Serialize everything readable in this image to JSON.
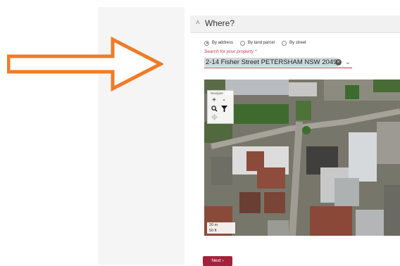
{
  "section": {
    "title": "Where?",
    "collapse_icon": "chevron-up-icon"
  },
  "search_options": [
    {
      "label": "By address",
      "selected": true
    },
    {
      "label": "By land parcel",
      "selected": false
    },
    {
      "label": "By street",
      "selected": false
    }
  ],
  "search": {
    "label": "Search for your property *",
    "value": "2-14 Fisher Street PETERSHAM  NSW  2049",
    "clear_icon": "clear-icon",
    "dropdown_icon": "chevron-down-icon"
  },
  "map": {
    "tools_label": "Navigate",
    "tools": [
      "zoom-in-icon",
      "zoom-out-icon",
      "search-icon",
      "filter-icon",
      "locate-icon"
    ],
    "zoom_in_glyph": "+",
    "zoom_out_glyph": "-",
    "scale_metric": "20 m",
    "scale_imperial": "50 ft"
  },
  "actions": {
    "next_label": "Next",
    "next_icon": "chevron-right-icon"
  },
  "annotation": {
    "arrow_color": "#f07c28"
  },
  "colors": {
    "accent": "#c0394b",
    "button": "#a3223b"
  }
}
